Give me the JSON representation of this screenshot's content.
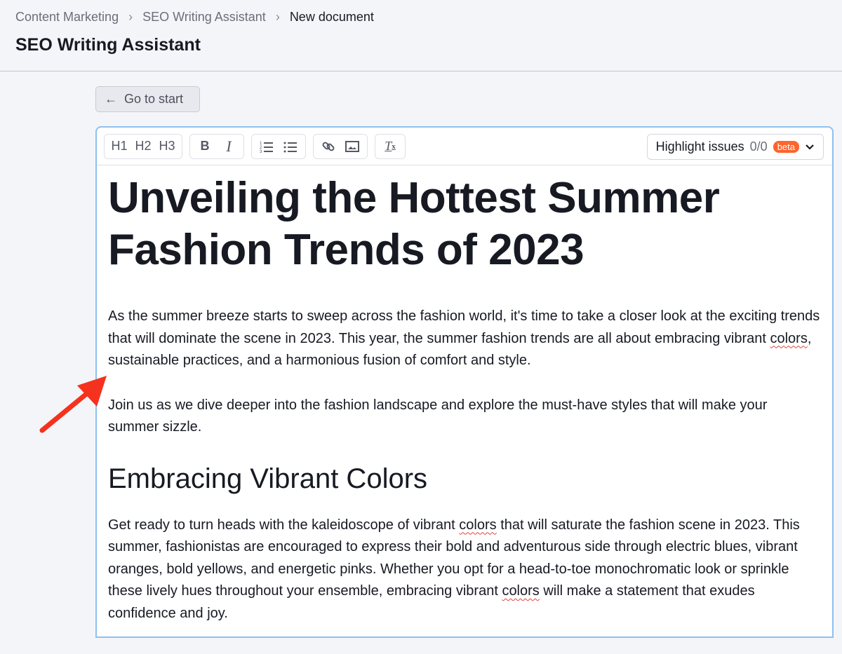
{
  "breadcrumb": [
    "Content Marketing",
    "SEO Writing Assistant",
    "New document"
  ],
  "page_title": "SEO Writing Assistant",
  "back_button": "Go to start",
  "toolbar": {
    "h1": "H1",
    "h2": "H2",
    "h3": "H3",
    "bold": "B",
    "italic": "I",
    "highlight_label": "Highlight issues",
    "highlight_count": "0/0",
    "beta": "beta"
  },
  "doc": {
    "title": "Unveiling the Hottest Summer Fashion Trends of 2023",
    "p1a": "As the summer breeze starts to sweep across the fashion world, it's time to take a closer look at the exciting trends that will dominate the scene in 2023. This year, the summer fashion trends are all about embracing vibrant ",
    "p1w": "colors",
    "p1b": ", sustainable practices, and a harmonious fusion of comfort and style.",
    "p2": "Join us as we dive deeper into the fashion landscape and explore the must-have styles that will make your summer sizzle.",
    "h2": "Embracing Vibrant Colors",
    "p3a": "Get ready to turn heads with the kaleidoscope of vibrant ",
    "p3w": "colors",
    "p3b": " that will saturate the fashion scene in 2023. This summer, fashionistas are encouraged to express their bold and adventurous side through electric blues, vibrant oranges, bold yellows, and energetic pinks. Whether you opt for a head-to-toe monochromatic look or sprinkle these lively hues throughout your ensemble, embracing vibrant ",
    "p3w2": "colors",
    "p3c": " will make a statement that exudes confidence and joy."
  },
  "colors": {
    "accent": "#ff642d",
    "arrow": "#f5321e",
    "focus": "#8fc0ef"
  }
}
